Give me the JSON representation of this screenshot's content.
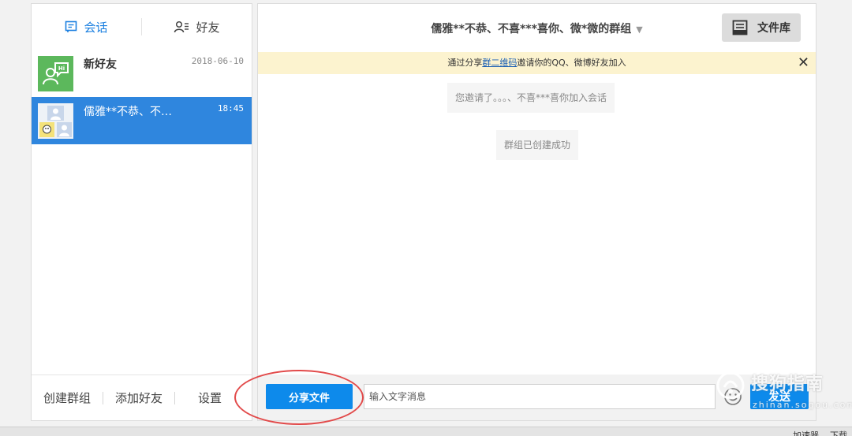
{
  "sidebar": {
    "tabs": [
      {
        "label": "会话",
        "icon": "chat-icon"
      },
      {
        "label": "好友",
        "icon": "contacts-icon"
      }
    ],
    "conversations": [
      {
        "name": "新好友",
        "time": "2018-06-10",
        "avatar": "new-friend-avatar"
      },
      {
        "name": "儒雅**不恭、不…",
        "time": "18:45",
        "avatar": "group-avatar"
      }
    ],
    "footer": [
      "创建群组",
      "添加好友",
      "设置"
    ]
  },
  "chat": {
    "title": "儒雅**不恭、不喜***喜你、微*微的群组",
    "title_caret": "▼",
    "file_library_label": "文件库",
    "banner": {
      "prefix": "通过分享",
      "link": "群二维码",
      "suffix": "邀请你的QQ、微博好友加入",
      "close": "✕"
    },
    "system_messages": [
      "您邀请了。。。、不喜***喜你加入会话",
      "群组已创建成功"
    ],
    "input": {
      "share_label": "分享文件",
      "placeholder": "输入文字消息",
      "send_label": "发送"
    }
  },
  "watermark": {
    "main": "搜狗指南",
    "sub": "zhinan.sogou.com"
  },
  "taskbar": [
    "加速器",
    "下载"
  ],
  "colors": {
    "accent": "#0d8aeb",
    "selected": "#2f86de",
    "banner": "#fcf3cf",
    "annotation": "#e24a4a"
  }
}
